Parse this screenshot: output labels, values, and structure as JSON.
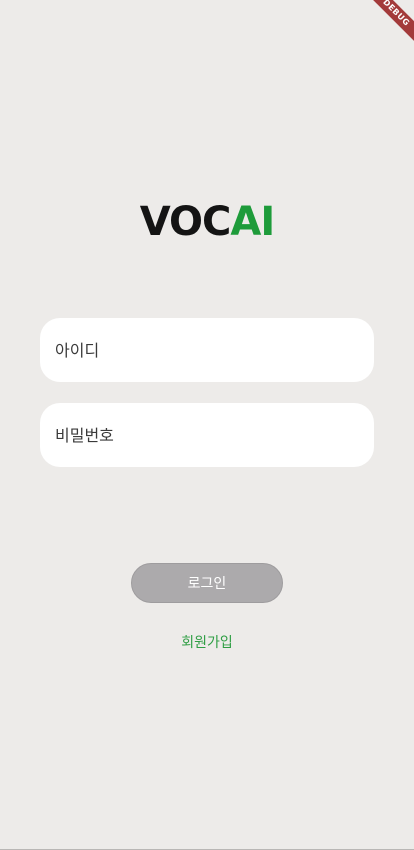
{
  "debug_banner": {
    "label": "DEBUG"
  },
  "logo": {
    "part1": "VOC",
    "part2": "AI"
  },
  "login_form": {
    "id_field": {
      "placeholder": "아이디",
      "value": ""
    },
    "password_field": {
      "placeholder": "비밀번호",
      "value": ""
    },
    "login_button": {
      "label": "로그인"
    },
    "signup_link": {
      "label": "회원가입"
    }
  },
  "colors": {
    "background": "#edebe9",
    "logo_accent": "#1e9b3a",
    "button": "#acaaac",
    "link": "#2f9e44"
  }
}
